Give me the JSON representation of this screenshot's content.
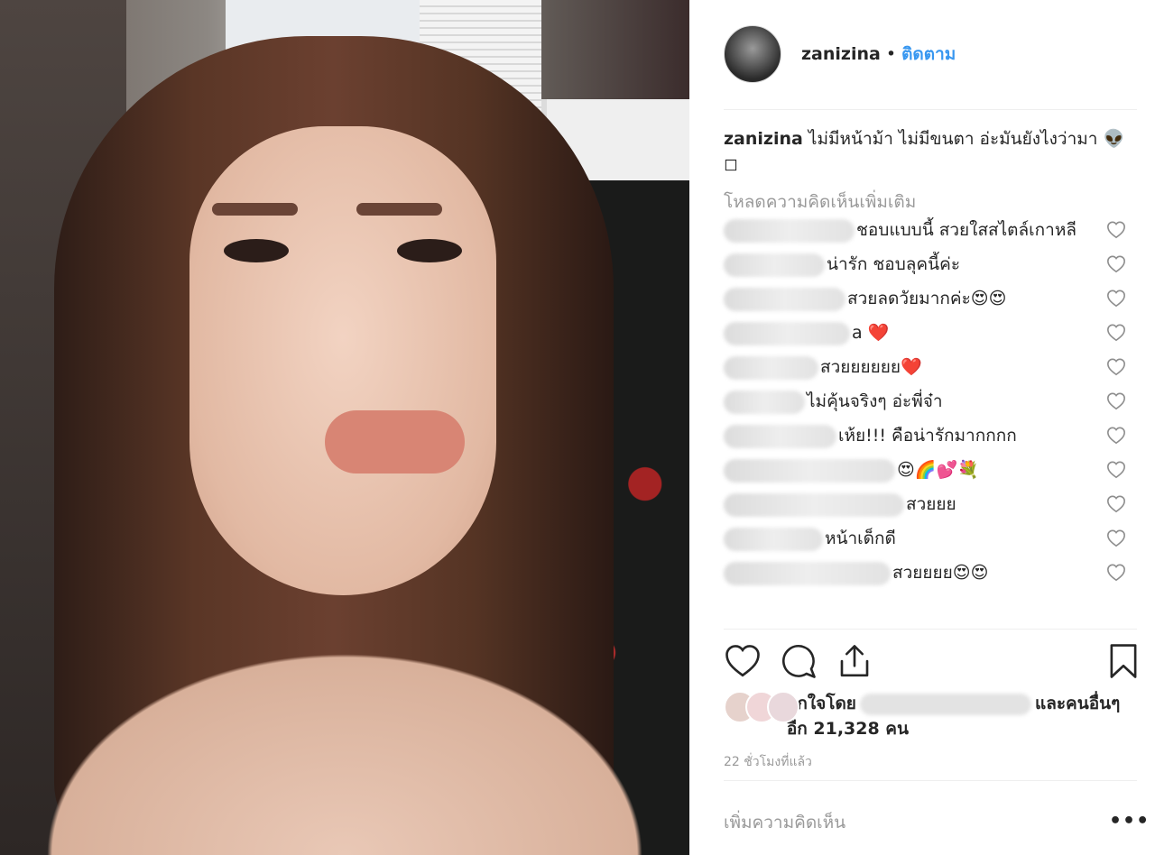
{
  "post": {
    "username": "zanizina",
    "follow_label": "ติดตาม",
    "separator": "•",
    "caption_text": "ไม่มีหน้าม้า ไม่มีขนตา อ่ะมันยังไงว่ามา 👽◻",
    "load_more": "โหลดความคิดเห็นเพิ่มเติม"
  },
  "comments": [
    {
      "text": "ชอบแบบนี้ สวยใสสไตล์เกาหลี"
    },
    {
      "text": "น่ารัก ชอบลุคนี้ค่ะ"
    },
    {
      "text": "สวยลดวัยมากค่ะ😍😍"
    },
    {
      "text": "a ❤️"
    },
    {
      "text": "สวยยยยยย❤️"
    },
    {
      "text": "ไม่คุ้นจริงๆ อ่ะพี่จ๋า"
    },
    {
      "text": "เห้ย!!! คือน่ารักมากกกก"
    },
    {
      "text": "😍🌈💕💐"
    },
    {
      "text": "สวยยย"
    },
    {
      "text": "หน้าเด็กดี"
    },
    {
      "text": "สวยยยย😍😍"
    }
  ],
  "likes": {
    "prefix": "ถูกใจโดย",
    "suffix": "และคนอื่นๆ อีก 21,328 คน"
  },
  "timestamp": "22 ชั่วโมงที่แล้ว",
  "add_comment_placeholder": "เพิ่มความคิดเห็น",
  "more_label": "•••",
  "colors": {
    "link": "#3897f0",
    "muted": "#999999",
    "text": "#262626"
  },
  "icons": [
    "heart-icon",
    "comment-icon",
    "share-icon",
    "bookmark-icon",
    "more-icon"
  ]
}
